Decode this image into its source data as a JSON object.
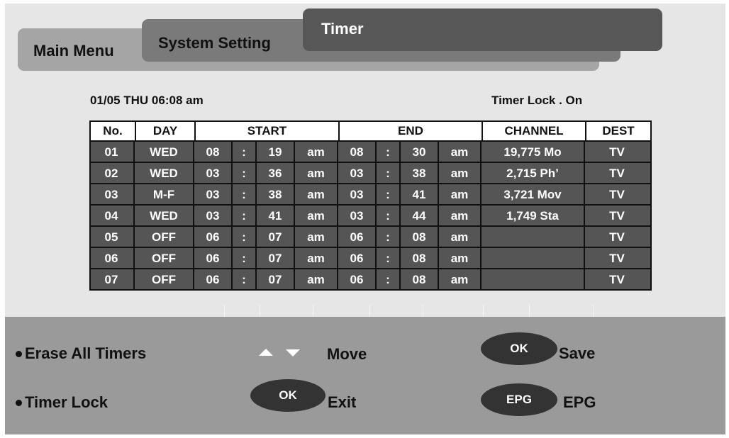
{
  "tabs": {
    "main_menu": "Main Menu",
    "system_setting": "System Setting",
    "timer": "Timer"
  },
  "status": {
    "datetime": "01/05 THU 06:08 am",
    "timer_lock": "Timer Lock . On"
  },
  "table": {
    "headers": {
      "no": "No.",
      "day": "DAY",
      "start": "START",
      "end": "END",
      "channel": "CHANNEL",
      "dest": "DEST"
    },
    "separator": ":",
    "rows": [
      {
        "no": "01",
        "day": "WED",
        "start_h": "08",
        "start_m": "19",
        "start_ap": "am",
        "end_h": "08",
        "end_m": "30",
        "end_ap": "am",
        "channel": "19,775 Mo",
        "dest": "TV"
      },
      {
        "no": "02",
        "day": "WED",
        "start_h": "03",
        "start_m": "36",
        "start_ap": "am",
        "end_h": "03",
        "end_m": "38",
        "end_ap": "am",
        "channel": "2,715 Ph’",
        "dest": "TV"
      },
      {
        "no": "03",
        "day": "M-F",
        "start_h": "03",
        "start_m": "38",
        "start_ap": "am",
        "end_h": "03",
        "end_m": "41",
        "end_ap": "am",
        "channel": "3,721 Mov",
        "dest": "TV"
      },
      {
        "no": "04",
        "day": "WED",
        "start_h": "03",
        "start_m": "41",
        "start_ap": "am",
        "end_h": "03",
        "end_m": "44",
        "end_ap": "am",
        "channel": "1,749 Sta",
        "dest": "TV"
      },
      {
        "no": "05",
        "day": "OFF",
        "start_h": "06",
        "start_m": "07",
        "start_ap": "am",
        "end_h": "06",
        "end_m": "08",
        "end_ap": "am",
        "channel": "",
        "dest": "TV"
      },
      {
        "no": "06",
        "day": "OFF",
        "start_h": "06",
        "start_m": "07",
        "start_ap": "am",
        "end_h": "06",
        "end_m": "08",
        "end_ap": "am",
        "channel": "",
        "dest": "TV"
      },
      {
        "no": "07",
        "day": "OFF",
        "start_h": "06",
        "start_m": "07",
        "start_ap": "am",
        "end_h": "06",
        "end_m": "08",
        "end_ap": "am",
        "channel": "",
        "dest": "TV"
      }
    ]
  },
  "panel": {
    "erase_all": "Erase All Timers",
    "timer_lock": "Timer Lock",
    "move": "Move",
    "ok_exit_btn": "OK",
    "exit": "Exit",
    "ok_save_btn": "OK",
    "save": "Save",
    "epg_btn": "EPG",
    "epg": "EPG"
  },
  "icons": {
    "bullet": "bullet-dot-icon",
    "arrow_up": "arrow-up-icon",
    "arrow_down": "arrow-down-icon"
  },
  "colors": {
    "tab_timer": "#575757",
    "tab_system": "#7a7a7a",
    "tab_main": "#a5a5a5",
    "row_bg": "#555555",
    "panel_bg": "#9a9a9a",
    "button_bg": "#333333"
  }
}
